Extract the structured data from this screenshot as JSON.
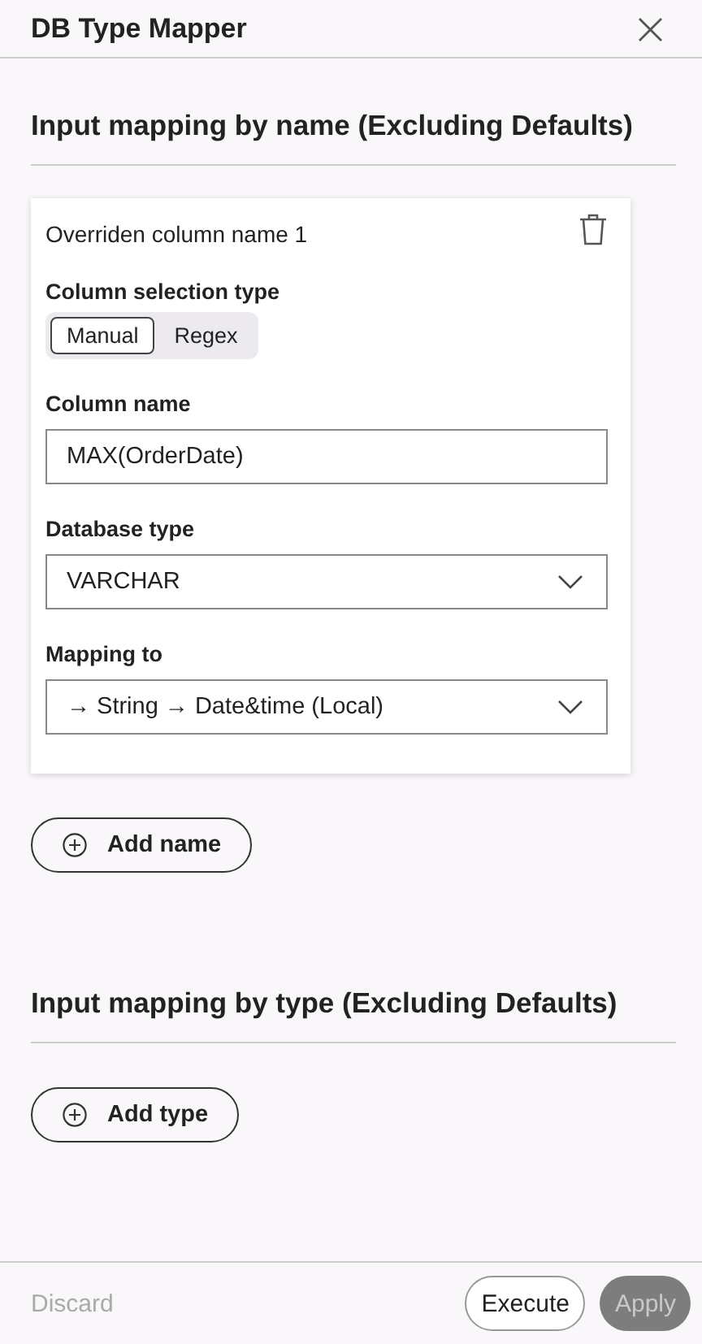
{
  "window": {
    "title": "DB Type Mapper",
    "close": "×"
  },
  "sections": [
    {
      "heading": "Input mapping by name (Excluding Defaults)",
      "cards": [
        {
          "title": "Overriden column name 1",
          "selection_label": "Column selection type",
          "options": [
            {
              "label": "Manual",
              "selected": true
            },
            {
              "label": "Regex",
              "selected": false
            }
          ],
          "fields": [
            {
              "kind": "input",
              "label": "Column name",
              "value": "MAX(OrderDate)"
            },
            {
              "kind": "select",
              "label": "Database type",
              "value": "VARCHAR"
            },
            {
              "kind": "select",
              "label": "Mapping to",
              "value": "→ String → Date&time (Local)"
            }
          ]
        }
      ],
      "add_button": "Add name"
    },
    {
      "heading": "Input mapping by type (Excluding Defaults)",
      "add_button": "Add type"
    }
  ],
  "footer": {
    "discard": {
      "label": "Discard",
      "disabled": true
    },
    "execute": {
      "label": "Execute",
      "disabled": false
    },
    "apply": {
      "label": "Apply",
      "disabled": true
    }
  }
}
